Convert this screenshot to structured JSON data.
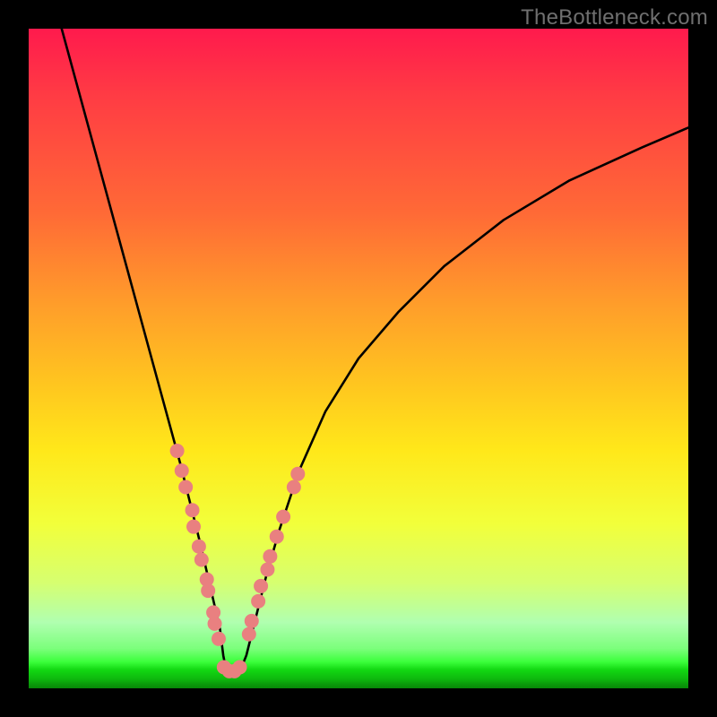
{
  "watermark": "TheBottleneck.com",
  "chart_data": {
    "type": "line",
    "title": "",
    "xlabel": "",
    "ylabel": "",
    "xlim": [
      0,
      100
    ],
    "ylim": [
      0,
      100
    ],
    "grid": false,
    "series": [
      {
        "name": "bottleneck-curve",
        "x": [
          5,
          8,
          11,
          14,
          17,
          20,
          23,
          26,
          29,
          29.5,
          30,
          30.5,
          31,
          32,
          33,
          34,
          36,
          38,
          41,
          45,
          50,
          56,
          63,
          72,
          82,
          93,
          100
        ],
        "y": [
          100,
          89,
          78,
          67,
          56,
          45,
          34,
          22,
          9,
          5,
          2.4,
          2.2,
          2.2,
          2.5,
          5,
          9,
          17,
          24,
          33,
          42,
          50,
          57,
          64,
          71,
          77,
          82,
          85
        ],
        "color": "#000000",
        "stroke_width": 2.6
      }
    ],
    "markers": [
      {
        "name": "left-cluster",
        "color": "#e98080",
        "radius": 8,
        "points": [
          {
            "x": 22.5,
            "y": 36.0
          },
          {
            "x": 23.2,
            "y": 33.0
          },
          {
            "x": 23.8,
            "y": 30.5
          },
          {
            "x": 24.8,
            "y": 27.0
          },
          {
            "x": 25.0,
            "y": 24.5
          },
          {
            "x": 25.8,
            "y": 21.5
          },
          {
            "x": 26.2,
            "y": 19.5
          },
          {
            "x": 27.0,
            "y": 16.5
          },
          {
            "x": 27.2,
            "y": 14.8
          },
          {
            "x": 28.0,
            "y": 11.5
          },
          {
            "x": 28.2,
            "y": 9.8
          },
          {
            "x": 28.8,
            "y": 7.5
          }
        ]
      },
      {
        "name": "bottom-cluster",
        "color": "#e98080",
        "radius": 8,
        "points": [
          {
            "x": 29.6,
            "y": 3.2
          },
          {
            "x": 30.4,
            "y": 2.6
          },
          {
            "x": 31.2,
            "y": 2.6
          },
          {
            "x": 32.0,
            "y": 3.2
          }
        ]
      },
      {
        "name": "right-cluster",
        "color": "#e98080",
        "radius": 8,
        "points": [
          {
            "x": 33.4,
            "y": 8.2
          },
          {
            "x": 33.8,
            "y": 10.2
          },
          {
            "x": 34.8,
            "y": 13.2
          },
          {
            "x": 35.2,
            "y": 15.5
          },
          {
            "x": 36.2,
            "y": 18.0
          },
          {
            "x": 36.6,
            "y": 20.0
          },
          {
            "x": 37.6,
            "y": 23.0
          },
          {
            "x": 38.6,
            "y": 26.0
          },
          {
            "x": 40.2,
            "y": 30.5
          },
          {
            "x": 40.8,
            "y": 32.5
          }
        ]
      }
    ]
  }
}
